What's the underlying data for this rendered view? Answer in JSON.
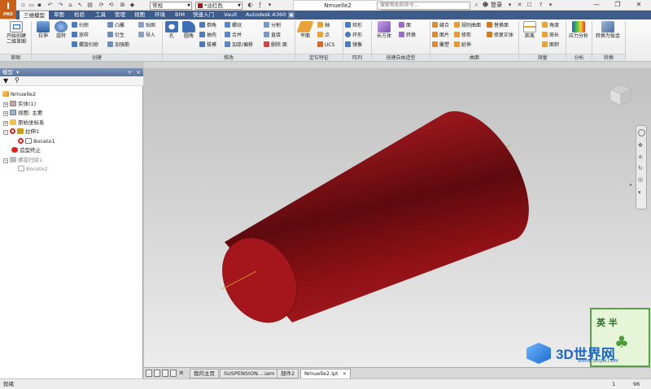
{
  "titlebar": {
    "app_logo": "I",
    "app_logo_sub": "PRO",
    "style_combo": "常规",
    "color_combo": "*淡红色",
    "document_title": "Nmuelle2",
    "search_placeholder": "搜索帮助和命令...",
    "user": "登录",
    "help": "?"
  },
  "tabs": [
    "三维模型",
    "草图",
    "检验",
    "工具",
    "管理",
    "视图",
    "环境",
    "BIM",
    "快速入门",
    "Vault",
    "Autodesk A360"
  ],
  "ribbon": {
    "sketch": {
      "btn": "开始创建",
      "btn2": "二维草图",
      "panel": "草图"
    },
    "create": {
      "extrude": "拉伸",
      "revolve": "旋转",
      "sweep": "扫掠",
      "loft": "放样",
      "coil": "螺旋扫掠",
      "emboss": "凸雕",
      "derive": "衍生",
      "rib": "加强筋",
      "decal": "贴图",
      "import": "导入",
      "panel": "创建"
    },
    "modify": {
      "hole": "孔",
      "fillet": "圆角",
      "chamfer": "倒角",
      "shell": "抽壳",
      "draft": "拔模",
      "thread": "螺纹",
      "combine": "合并",
      "thicken": "加厚/偏移",
      "split": "分割",
      "direct": "直接",
      "delete_face": "删除 面",
      "panel": "修改"
    },
    "work": {
      "plane": "平面",
      "axis": "轴",
      "point": "点",
      "ucs": "UCS",
      "panel": "定位特征"
    },
    "pattern": {
      "rect": "矩形",
      "circ": "环形",
      "mirror": "镜像",
      "panel": "阵列"
    },
    "freeform": {
      "box": "长方体",
      "face": "面",
      "convert": "转换",
      "panel": "创建自由造型"
    },
    "surface": {
      "stitch": "缝合",
      "patch": "面片",
      "sculpt": "雕塑",
      "ruled": "规则曲面",
      "trim": "修剪",
      "extend": "延伸",
      "replace": "替换面",
      "repair": "修复实体",
      "panel": "曲面"
    },
    "measure": {
      "distance": "距离",
      "angle": "角度",
      "loop": "周长",
      "area": "面积",
      "panel": "测量"
    },
    "analysis": {
      "stress": "应力分析",
      "panel": "分析"
    },
    "convert": {
      "sheetmetal": "转换为钣金",
      "panel": "转换"
    }
  },
  "browser": {
    "header": "模型",
    "pin": "+",
    "close": "×",
    "tree": [
      {
        "label": "Nmuelle2",
        "indent": 0,
        "exp": ""
      },
      {
        "label": "实体(1)",
        "indent": 1,
        "exp": "+"
      },
      {
        "label": "视图: 主要",
        "indent": 1,
        "exp": "+"
      },
      {
        "label": "原始坐标系",
        "indent": 1,
        "exp": "+"
      },
      {
        "label": "拉伸1",
        "indent": 1,
        "exp": "−"
      },
      {
        "label": "Boceto1",
        "indent": 2,
        "exp": ""
      },
      {
        "label": "造型终止",
        "indent": 1,
        "exp": ""
      },
      {
        "label": "螺旋扫掠1",
        "indent": 1,
        "exp": "−"
      },
      {
        "label": "Boceto2",
        "indent": 2,
        "exp": ""
      }
    ]
  },
  "doctabs": [
    "我的主页",
    "SUSPENSION....iam",
    "部件2",
    "Nmuelle2.ipt"
  ],
  "status": {
    "left": "就绪",
    "n1": "1",
    "n2": "96"
  },
  "watermark": {
    "text": "3D世界网",
    "url": "WWW.3DSJW.COM",
    "stamp_chars": "英 半"
  },
  "colors": {
    "ribbon_tab_bg": "#3d5c8c",
    "part_red": "#8f1116",
    "app_orange": "#c8601a"
  }
}
